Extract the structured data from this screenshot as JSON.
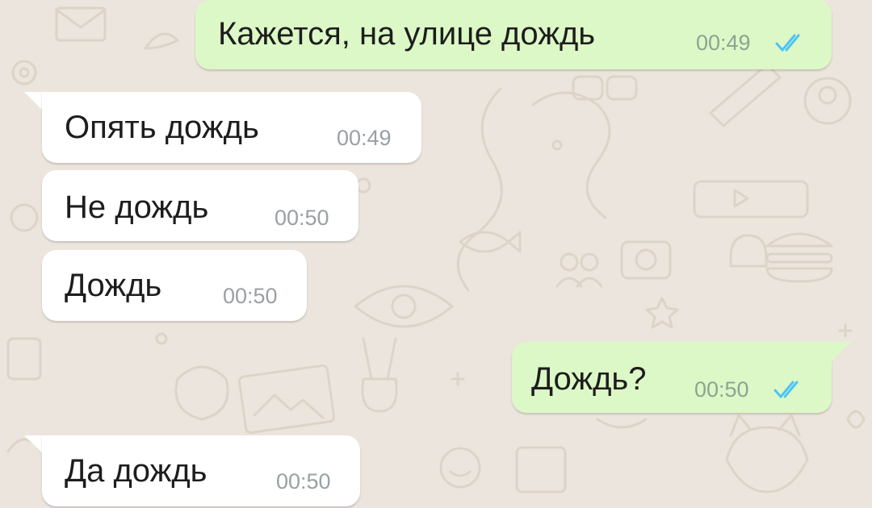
{
  "colors": {
    "background": "#ECE5DD",
    "incoming_bubble": "#FFFFFF",
    "outgoing_bubble": "#DCF8C6",
    "read_ticks": "#4FC3F7",
    "time_text": "#9AA0A4"
  },
  "messages": [
    {
      "direction": "out",
      "text": "Кажется, на улице дождь",
      "time": "00:49",
      "status": "read",
      "status_icon": "double-check-icon"
    },
    {
      "direction": "in",
      "text": "Опять дождь",
      "time": "00:49"
    },
    {
      "direction": "in",
      "text": "Не дождь",
      "time": "00:50"
    },
    {
      "direction": "in",
      "text": "Дождь",
      "time": "00:50"
    },
    {
      "direction": "out",
      "text": "Дождь?",
      "time": "00:50",
      "status": "read",
      "status_icon": "double-check-icon"
    },
    {
      "direction": "in",
      "text": "Да дождь",
      "time": "00:50"
    }
  ]
}
